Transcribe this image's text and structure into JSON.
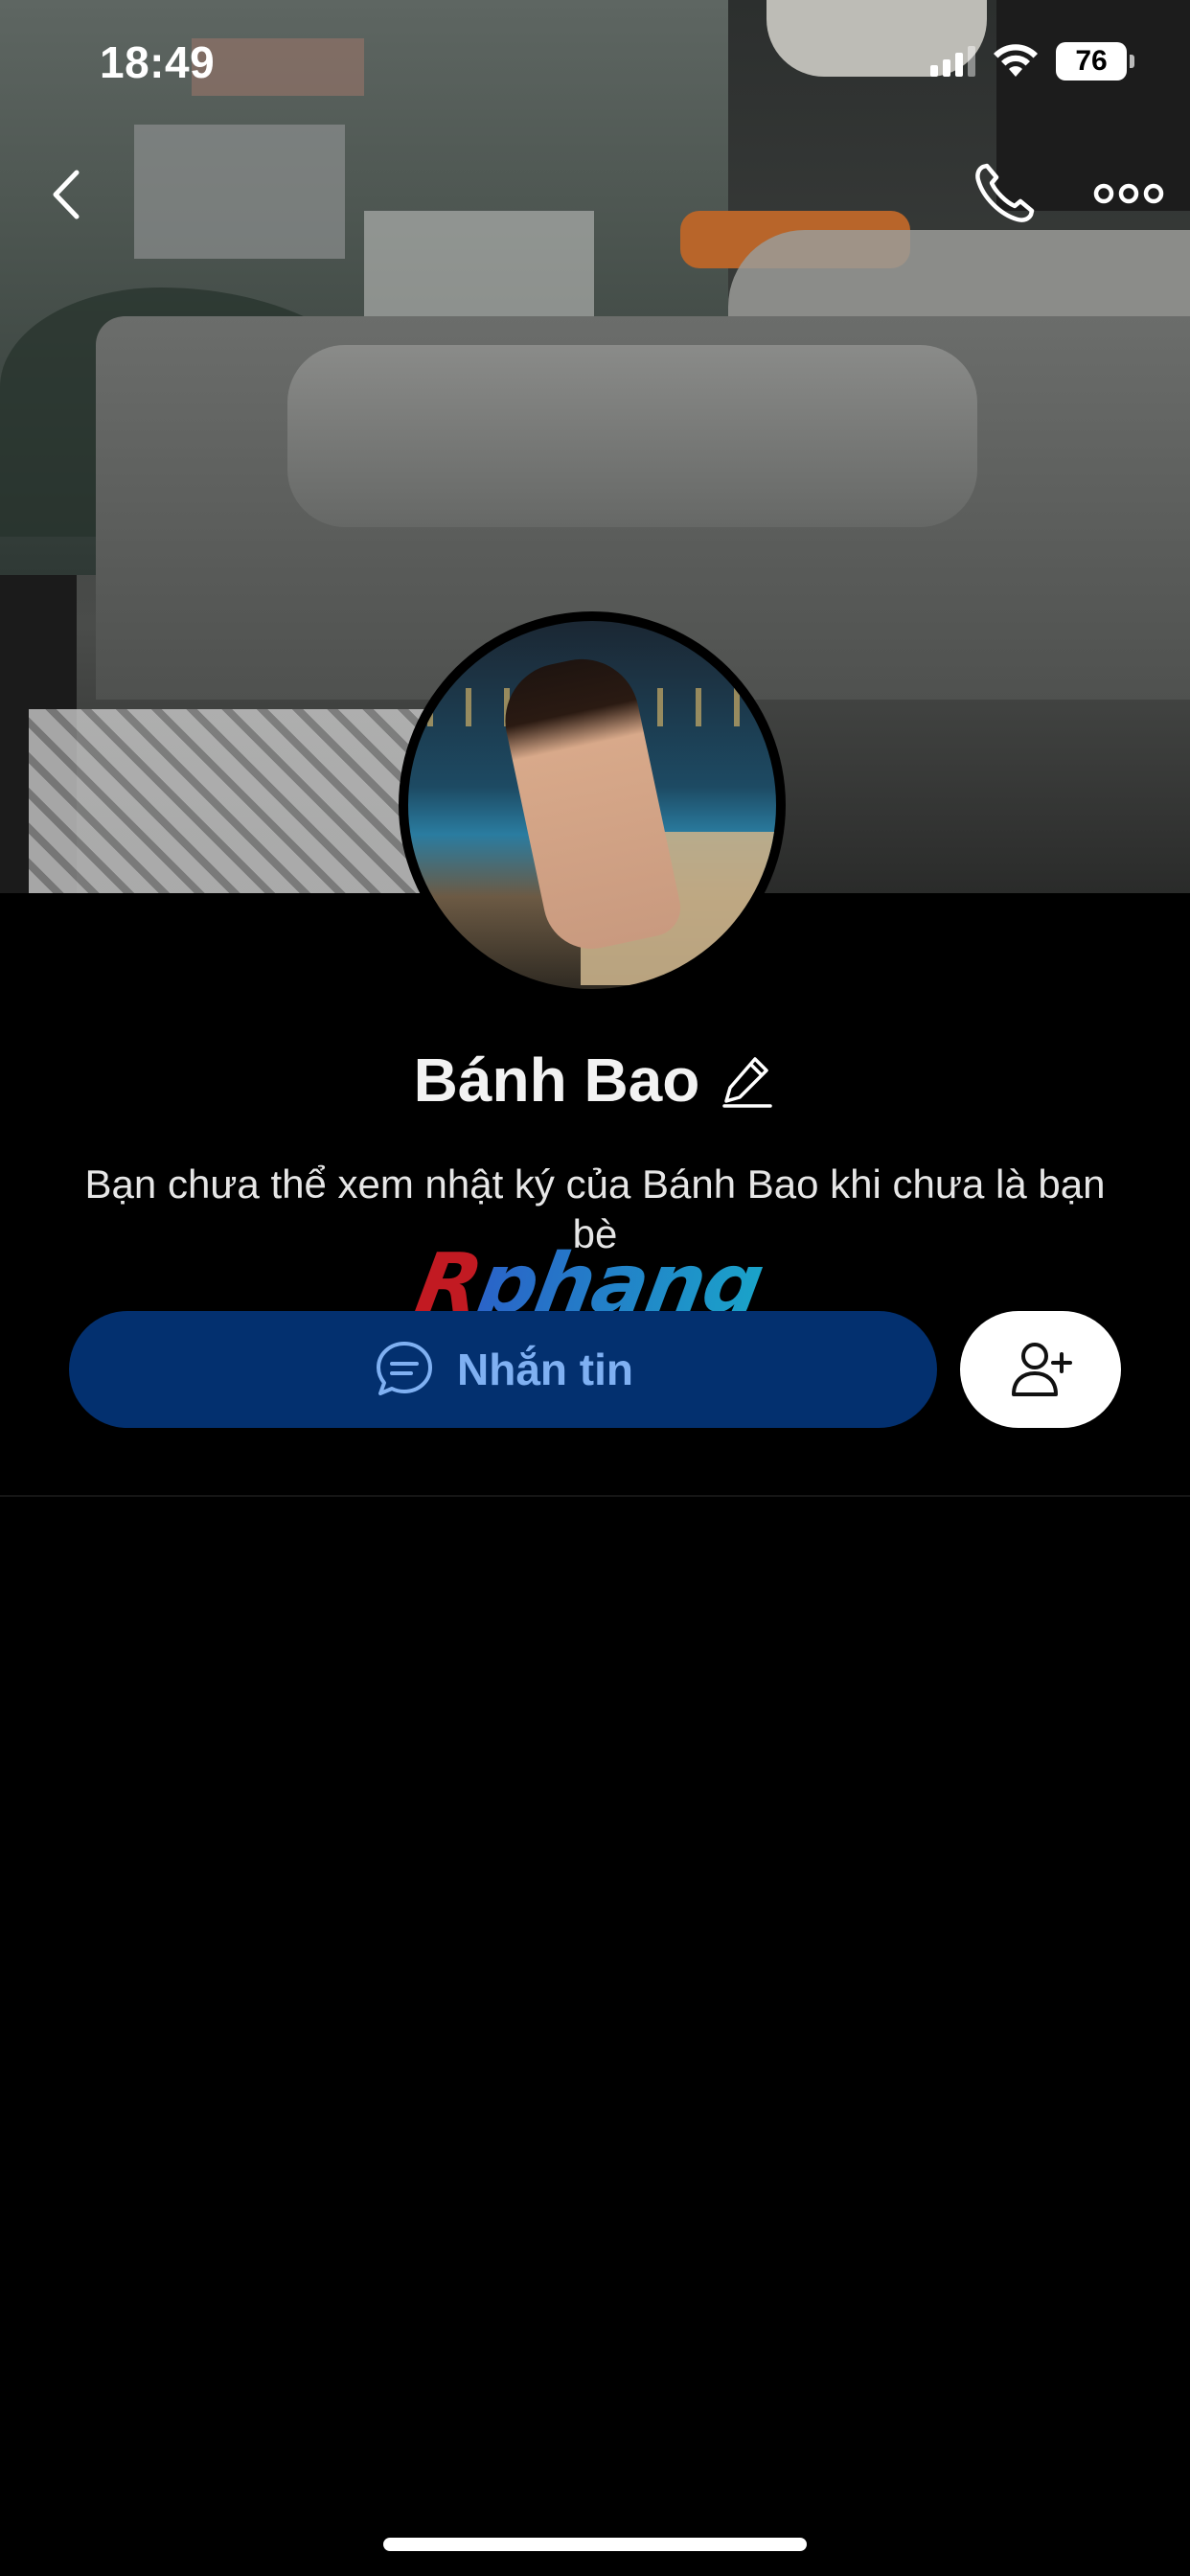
{
  "status_bar": {
    "time": "18:49",
    "battery": "76",
    "icons": [
      "signal-icon",
      "wifi-icon",
      "battery-icon"
    ]
  },
  "nav": {
    "icons": [
      "back-chevron-icon",
      "phone-call-icon",
      "more-options-icon"
    ]
  },
  "profile": {
    "name": "Bánh Bao",
    "edit_icon": "pencil-icon",
    "notice": "Bạn chưa thể xem nhật ký của Bánh Bao khi chưa là bạn bè"
  },
  "watermark": {
    "part1": "R",
    "part2": "phang"
  },
  "actions": {
    "message_label": "Nhắn tin",
    "message_icon": "chat-bubble-icon",
    "add_friend_icon": "add-friend-icon",
    "message_button_color": "#03306f",
    "message_text_color": "#7fb0f2"
  }
}
